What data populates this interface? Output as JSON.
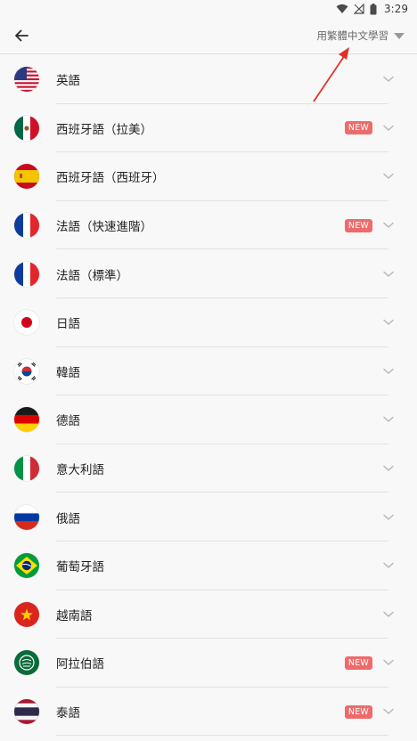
{
  "status_bar": {
    "time": "3:29"
  },
  "app_bar": {
    "language_selector_label": "用繁體中文學習"
  },
  "languages": [
    {
      "name": "英語",
      "flag": "flag-us-icon",
      "new": ""
    },
    {
      "name": "西班牙語（拉美）",
      "flag": "flag-mx-icon",
      "new": "NEW"
    },
    {
      "name": "西班牙語（西班牙）",
      "flag": "flag-es-icon",
      "new": ""
    },
    {
      "name": "法語（快速進階）",
      "flag": "flag-fr-icon",
      "new": "NEW"
    },
    {
      "name": "法語（標準）",
      "flag": "flag-fr-icon",
      "new": ""
    },
    {
      "name": "日語",
      "flag": "flag-jp-icon",
      "new": ""
    },
    {
      "name": "韓語",
      "flag": "flag-kr-icon",
      "new": ""
    },
    {
      "name": "德語",
      "flag": "flag-de-icon",
      "new": ""
    },
    {
      "name": "意大利語",
      "flag": "flag-it-icon",
      "new": ""
    },
    {
      "name": "俄語",
      "flag": "flag-ru-icon",
      "new": ""
    },
    {
      "name": "葡萄牙語",
      "flag": "flag-br-icon",
      "new": ""
    },
    {
      "name": "越南語",
      "flag": "flag-vn-icon",
      "new": ""
    },
    {
      "name": "阿拉伯語",
      "flag": "flag-sa-icon",
      "new": "NEW"
    },
    {
      "name": "泰語",
      "flag": "flag-th-icon",
      "new": "NEW"
    }
  ],
  "colors": {
    "badge": "#ee6b6b",
    "annotation_arrow": "#e0302a"
  }
}
